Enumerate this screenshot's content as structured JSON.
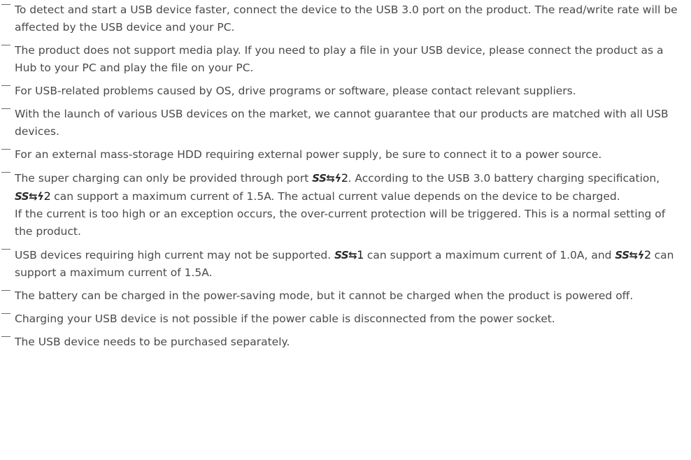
{
  "notes": [
    {
      "parts": [
        "To detect and start a USB device faster, connect the device to the USB 3.0 port on the product. The read/write rate will be affected by the USB device and your PC."
      ]
    },
    {
      "parts": [
        "The product does not support media play. If you need to play a file in your USB device, please connect the product as a Hub to your PC and play the file on your PC."
      ]
    },
    {
      "parts": [
        "For USB-related problems caused by OS, drive programs or software, please contact relevant suppliers."
      ]
    },
    {
      "parts": [
        "With the launch of various USB devices on the market, we cannot guarantee that our products are matched with all USB devices."
      ]
    },
    {
      "parts": [
        "For an external mass-storage HDD requiring external power supply, be sure to connect it to a power source."
      ]
    },
    {
      "p1a": "The super charging can only be provided through port ",
      "sym_charge_text": "SS",
      "sym_charge_arrow": "⇆",
      "sym_charge_bolt": "ϟ",
      "sym_charge_port": "2",
      "p1b": ". According to the USB 3.0 battery charging specification, ",
      "p1c": " can support a maximum current of 1.5A. The actual current value depends on the device to be charged.",
      "p2": "If the current is too high or an exception occurs, the over-current protection will be triggered. This is a normal setting of the product."
    },
    {
      "p1a": "USB devices requiring high current may not be supported. ",
      "sym_std_text": "SS",
      "sym_std_arrow": "⇆",
      "sym_std_port": "1",
      "p1b": " can support a maximum current of 1.0A, and ",
      "p1c": " can support a maximum current of 1.5A."
    },
    {
      "parts": [
        "The battery can be charged in the power-saving mode, but it cannot be charged when the product is powered off."
      ]
    },
    {
      "parts": [
        "Charging your USB device is not possible if the power cable is disconnected from the power socket."
      ]
    },
    {
      "parts": [
        "The USB device needs to be purchased separately."
      ]
    }
  ]
}
